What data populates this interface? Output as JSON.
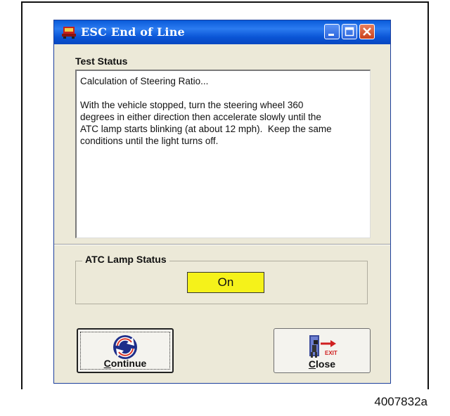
{
  "window": {
    "title": "ESC End of Line"
  },
  "test_status": {
    "label": "Test Status",
    "text": "Calculation of Steering Ratio...\n\nWith the vehicle stopped, turn the steering wheel 360\ndegrees in either direction then accelerate slowly until the\nATC lamp starts blinking (at about 12 mph).  Keep the same\nconditions until the light turns off."
  },
  "atc_lamp": {
    "label": "ATC Lamp Status",
    "value": "On",
    "color": "#f5f21a"
  },
  "buttons": {
    "continue_first": "C",
    "continue_rest": "ontinue",
    "close_first": "C",
    "close_rest": "lose"
  },
  "icons": {
    "app": "esc-app-icon",
    "continue": "refresh-arrows-icon",
    "close": "exit-door-icon"
  },
  "figure_id": "4007832a"
}
